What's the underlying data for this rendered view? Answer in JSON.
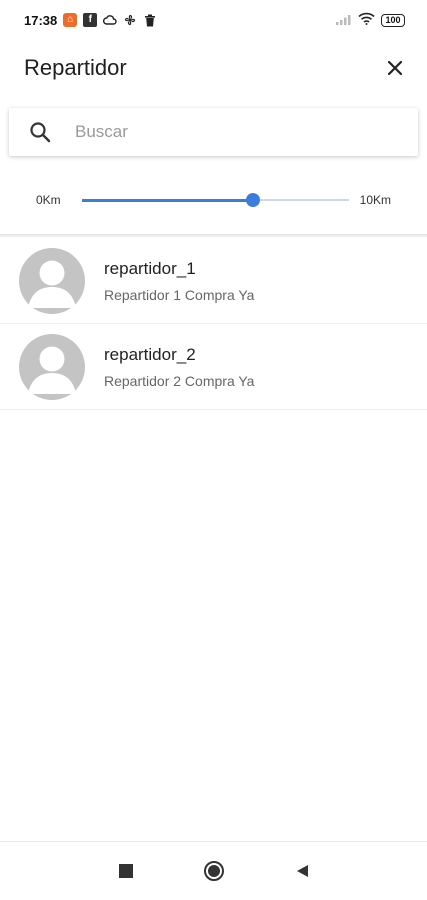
{
  "status_bar": {
    "time": "17:38",
    "battery": "100",
    "notification_icons": [
      "app-notification-icon",
      "facebook-icon",
      "cloud-icon",
      "fan-icon",
      "trash-icon"
    ],
    "system_icons": [
      "signal-icon",
      "wifi-icon",
      "battery-icon"
    ]
  },
  "header": {
    "title": "Repartidor"
  },
  "search": {
    "placeholder": "Buscar",
    "value": ""
  },
  "distance_filter": {
    "min_label": "0Km",
    "max_label": "10Km",
    "value_fraction": 0.64
  },
  "drivers": [
    {
      "name": "repartidor_1",
      "subtitle": "Repartidor 1 Compra Ya"
    },
    {
      "name": "repartidor_2",
      "subtitle": "Repartidor 2 Compra Ya"
    }
  ],
  "colors": {
    "accent": "#3b7ddd",
    "track": "#c8d8f4",
    "avatar": "#c4c4c4"
  }
}
